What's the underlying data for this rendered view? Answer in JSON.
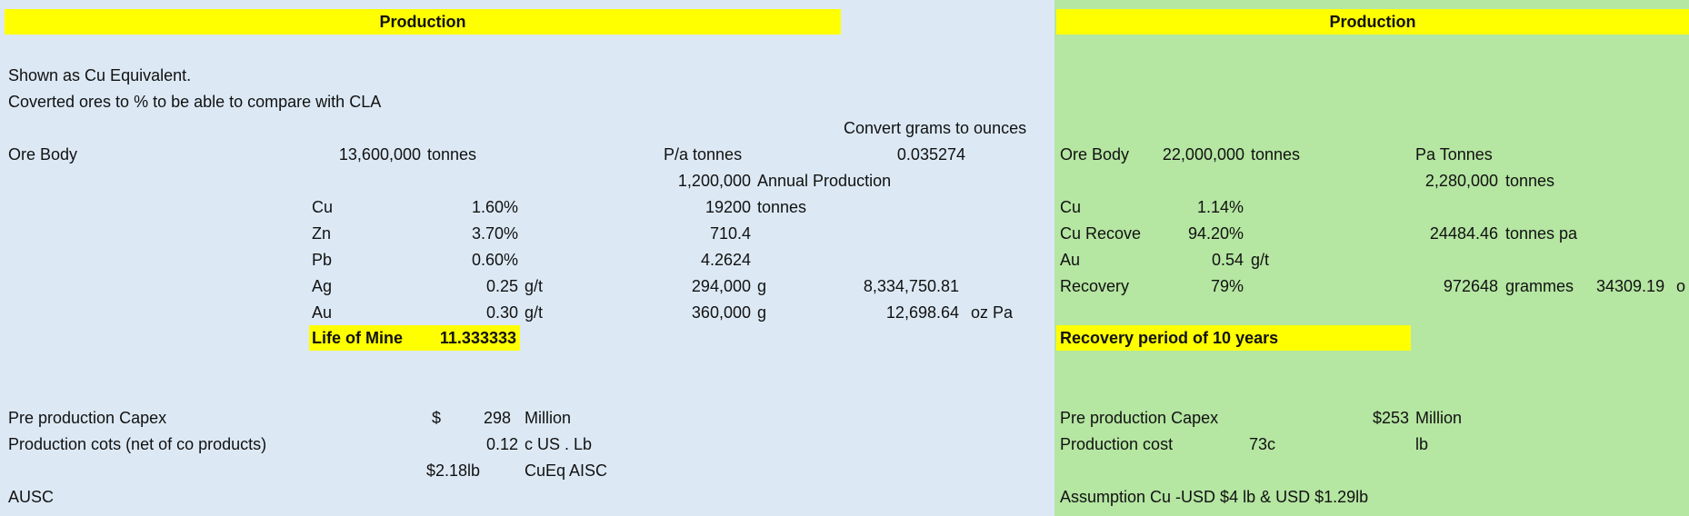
{
  "left": {
    "banner": "Production",
    "note1": "Shown as Cu Equivalent.",
    "note2": "Coverted ores to % to be able to compare with CLA",
    "convert_label": "Convert grams to ounces",
    "ore_body_label": "Ore Body",
    "ore_body_value": "13,600,000",
    "ore_body_unit": "tonnes",
    "pa_tonnes_label": "P/a tonnes",
    "pa_factor": "0.035274",
    "annual_value": "1,200,000",
    "annual_label": "Annual Production",
    "grades": [
      {
        "metal": "Cu",
        "pct": "1.60%",
        "unit": "",
        "prod": "19200",
        "prod_unit": "tonnes",
        "oz": "",
        "oz_unit": ""
      },
      {
        "metal": "Zn",
        "pct": "3.70%",
        "unit": "",
        "prod": "710.4",
        "prod_unit": "",
        "oz": "",
        "oz_unit": ""
      },
      {
        "metal": "Pb",
        "pct": "0.60%",
        "unit": "",
        "prod": "4.2624",
        "prod_unit": "",
        "oz": "",
        "oz_unit": ""
      },
      {
        "metal": "Ag",
        "pct": "0.25",
        "unit": "g/t",
        "prod": "294,000",
        "prod_unit": "g",
        "oz": "8,334,750.81",
        "oz_unit": ""
      },
      {
        "metal": "Au",
        "pct": "0.30",
        "unit": "g/t",
        "prod": "360,000",
        "prod_unit": "g",
        "oz": "12,698.64",
        "oz_unit": "oz Pa"
      }
    ],
    "life_label": "Life of Mine",
    "life_value": "11.333333",
    "capex_label": "Pre production Capex",
    "capex_currency": "$",
    "capex_value": "298",
    "capex_unit": "Million",
    "cost_label": "Production cots (net of co products)",
    "cost_value": "0.12",
    "cost_unit": "c US . Lb",
    "aisc_value": "$2.18lb",
    "aisc_label": "CuEq AISC",
    "ausc_label": "AUSC"
  },
  "right": {
    "banner": "Production",
    "ore_body_label": "Ore Body",
    "ore_body_value": "22,000,000",
    "ore_body_unit": "tonnes",
    "pa_tonnes_label": "Pa Tonnes",
    "pa_value": "2,280,000",
    "pa_unit": "tonnes",
    "cu_label": "Cu",
    "cu_value": "1.14%",
    "cu_rec_label": "Cu Recove",
    "cu_rec_value": "94.20%",
    "cu_pa_value": "24484.46",
    "cu_pa_unit": "tonnes pa",
    "au_label": "Au",
    "au_value": "0.54",
    "au_unit": "g/t",
    "rec_label": "Recovery",
    "rec_value": "79%",
    "grammes_value": "972648",
    "grammes_unit": "grammes",
    "oz_value": "34309.19",
    "oz_unit": "o",
    "period_label": "Recovery period of 10 years",
    "capex_label": "Pre production Capex",
    "capex_value": "$253",
    "capex_unit": "Million",
    "cost_label": "Production cost",
    "cost_value": "73c",
    "cost_unit": "lb",
    "assumption": "Assumption Cu -USD $4 lb & USD $1.29lb"
  }
}
